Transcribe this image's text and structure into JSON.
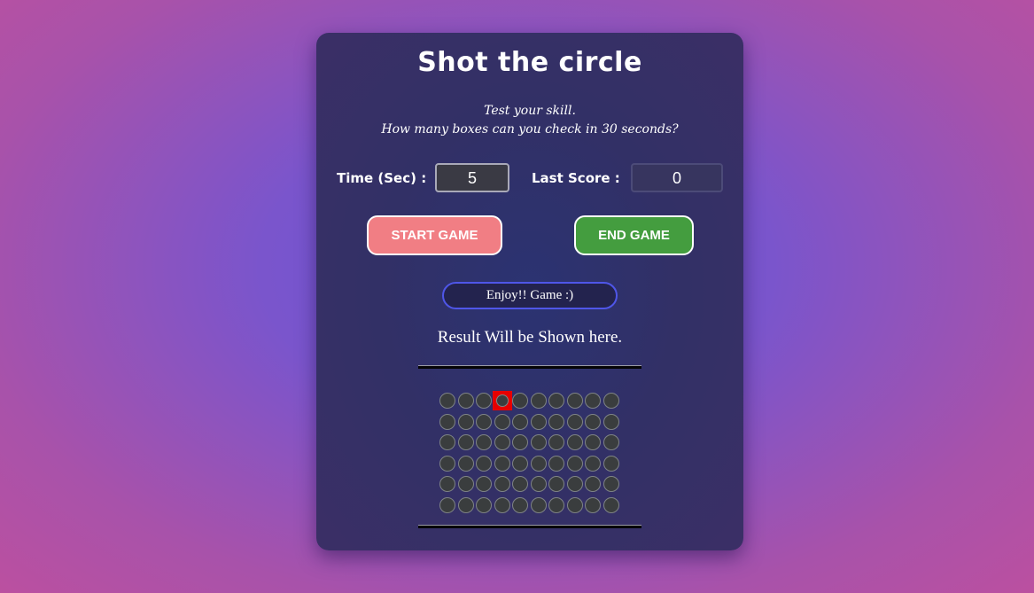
{
  "title": "Shot the circle",
  "subtitle": {
    "line1": "Test your skill.",
    "line2": "How many boxes can you check in 30 seconds?"
  },
  "time": {
    "label": "Time (Sec) :",
    "value": "5"
  },
  "score": {
    "label": "Last Score :",
    "value": "0"
  },
  "buttons": {
    "start": "START GAME",
    "end": "END GAME"
  },
  "status": "Enjoy!! Game :)",
  "result": "Result Will be Shown here.",
  "grid": {
    "rows": 6,
    "cols": 10,
    "active_cell": {
      "row": 0,
      "col": 3
    }
  },
  "colors": {
    "start_button": "#f17e84",
    "end_button": "#449d3f",
    "active_cell": "#e60000",
    "status_border": "#4f56e8"
  }
}
